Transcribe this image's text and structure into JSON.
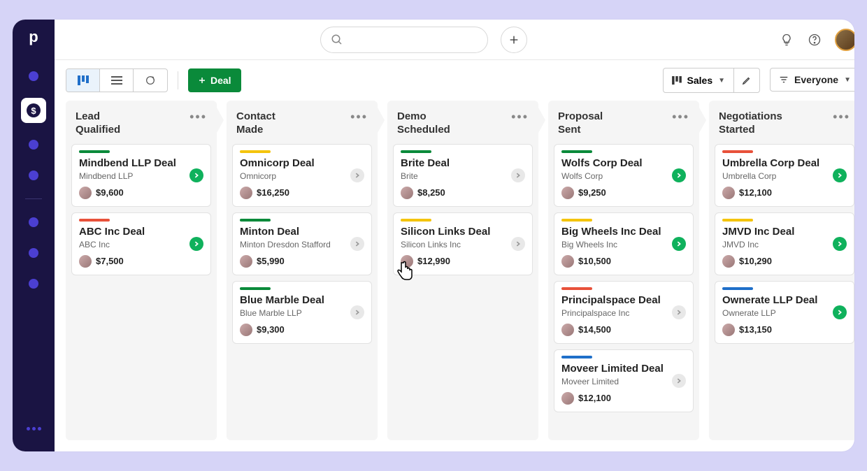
{
  "topbar": {
    "search_placeholder": ""
  },
  "toolbar": {
    "new_deal_label": "Deal",
    "pipeline_label": "Sales",
    "filter_label": "Everyone"
  },
  "columns": [
    {
      "title": "Lead Qualified",
      "cards": [
        {
          "stripe": "green",
          "title": "Mindbend LLP Deal",
          "sub": "Mindbend LLP",
          "amount": "$9,600",
          "action": "go"
        },
        {
          "stripe": "red",
          "title": "ABC Inc Deal",
          "sub": "ABC Inc",
          "amount": "$7,500",
          "action": "go"
        }
      ]
    },
    {
      "title": "Contact Made",
      "cards": [
        {
          "stripe": "yellow",
          "title": "Omnicorp Deal",
          "sub": "Omnicorp",
          "amount": "$16,250",
          "action": "next"
        },
        {
          "stripe": "green",
          "title": "Minton Deal",
          "sub": "Minton Dresdon Stafford",
          "amount": "$5,990",
          "action": "next"
        },
        {
          "stripe": "green",
          "title": "Blue Marble Deal",
          "sub": "Blue Marble LLP",
          "amount": "$9,300",
          "action": "next"
        }
      ]
    },
    {
      "title": "Demo Scheduled",
      "cards": [
        {
          "stripe": "green",
          "title": "Brite Deal",
          "sub": "Brite",
          "amount": "$8,250",
          "action": "next"
        },
        {
          "stripe": "yellow",
          "title": "Silicon Links Deal",
          "sub": "Silicon Links Inc",
          "amount": "$12,990",
          "action": "next"
        }
      ]
    },
    {
      "title": "Proposal Sent",
      "cards": [
        {
          "stripe": "green",
          "title": "Wolfs Corp Deal",
          "sub": "Wolfs Corp",
          "amount": "$9,250",
          "action": "go"
        },
        {
          "stripe": "yellow",
          "title": "Big Wheels Inc Deal",
          "sub": "Big Wheels Inc",
          "amount": "$10,500",
          "action": "go"
        },
        {
          "stripe": "red",
          "title": "Principalspace Deal",
          "sub": "Principalspace Inc",
          "amount": "$14,500",
          "action": "next"
        },
        {
          "stripe": "blue",
          "title": "Moveer Limited Deal",
          "sub": "Moveer Limited",
          "amount": "$12,100",
          "action": "next"
        }
      ]
    },
    {
      "title": "Negotiations Started",
      "cards": [
        {
          "stripe": "red",
          "title": "Umbrella Corp Deal",
          "sub": "Umbrella Corp",
          "amount": "$12,100",
          "action": "go"
        },
        {
          "stripe": "yellow",
          "title": "JMVD Inc Deal",
          "sub": "JMVD Inc",
          "amount": "$10,290",
          "action": "go"
        },
        {
          "stripe": "blue",
          "title": "Ownerate LLP Deal",
          "sub": "Ownerate LLP",
          "amount": "$13,150",
          "action": "go"
        }
      ]
    }
  ]
}
